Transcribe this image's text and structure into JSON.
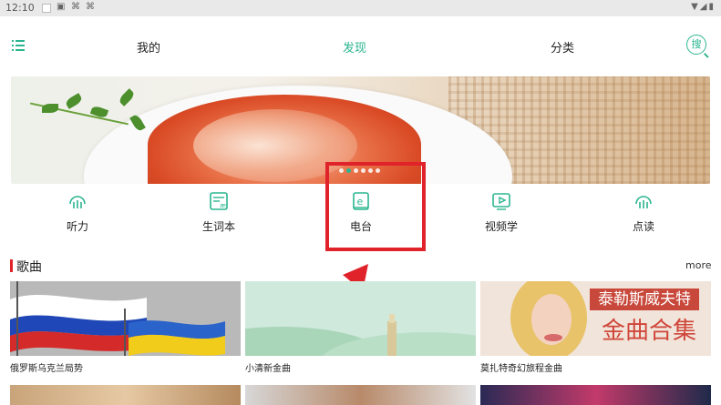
{
  "status_bar": {
    "time": "12:10",
    "icons": [
      "notification-square-icon",
      "a-box-icon",
      "chinese-char-icon",
      "chinese-char-icon"
    ],
    "right_icons": [
      "wifi-icon",
      "signal-icon",
      "battery-icon"
    ]
  },
  "nav": {
    "tabs": [
      {
        "label": "我的",
        "active": false
      },
      {
        "label": "发现",
        "active": true
      },
      {
        "label": "分类",
        "active": false
      }
    ],
    "search_label": "搜",
    "accent_color": "#2bb58f"
  },
  "banner": {
    "slide_count": 6,
    "active_index": 1
  },
  "categories": [
    {
      "label": "听力",
      "icon": "headphones-icon"
    },
    {
      "label": "生词本",
      "icon": "vocabulary-book-icon"
    },
    {
      "label": "电台",
      "icon": "radio-e-icon"
    },
    {
      "label": "视频学",
      "icon": "video-play-icon"
    },
    {
      "label": "点读",
      "icon": "headphones-icon"
    }
  ],
  "annotation": {
    "highlight_color": "#e0222a",
    "highlight_target": "电台"
  },
  "section": {
    "title": "歌曲",
    "more_label": "more",
    "bar_color": "#e0222a"
  },
  "albums": [
    {
      "caption": "俄罗斯乌克兰局势",
      "image": "russia-ukraine-flags"
    },
    {
      "caption": "小清新金曲",
      "image": "green-landscape"
    },
    {
      "caption": "莫扎特奇幻旅程金曲",
      "image": "singer-portrait",
      "overlay_line1": "泰勒斯威夫特",
      "overlay_line2": "金曲合集"
    }
  ]
}
